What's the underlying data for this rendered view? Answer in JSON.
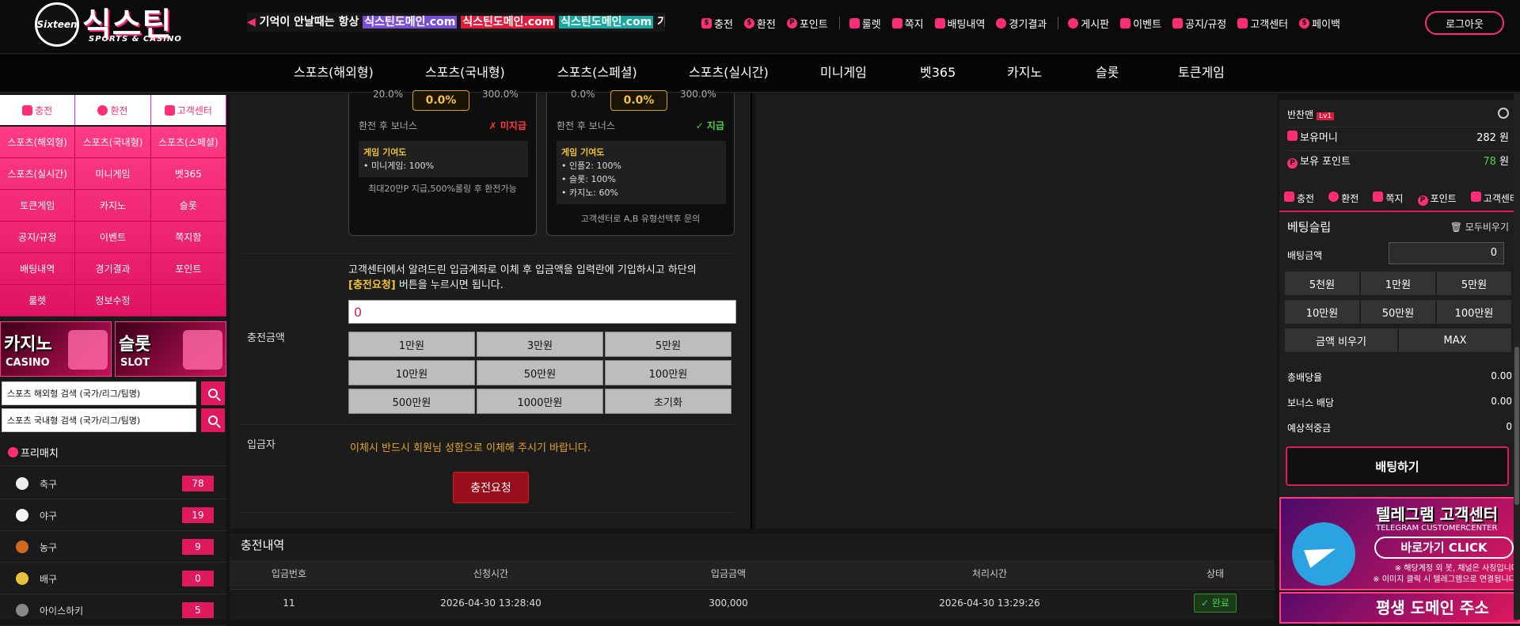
{
  "header": {
    "logo_badge": "Sixteen",
    "logo_title": "식스틴",
    "logo_sub": "SPORTS & CASINO",
    "ticker_pre": "기억이 안날때는 항상",
    "ticker_d1": "식스틴도메인.com",
    "ticker_d2": "식스틴도메인.com",
    "ticker_d3": "식스틴도메인.com",
    "ticker_post": "기억해 주",
    "nav1": [
      "충전",
      "환전",
      "포인트"
    ],
    "nav2": [
      "룰렛",
      "쪽지",
      "배팅내역",
      "경기결과"
    ],
    "nav3": [
      "게시판",
      "이벤트",
      "공지/규정",
      "고객센터",
      "페이백"
    ],
    "logout": "로그아웃"
  },
  "mainnav": [
    "스포츠(해외형)",
    "스포츠(국내형)",
    "스포츠(스페셜)",
    "스포츠(실시간)",
    "미니게임",
    "벳365",
    "카지노",
    "슬롯",
    "토큰게임"
  ],
  "left": {
    "quick_tabs": [
      "충전",
      "환전",
      "고객센터"
    ],
    "grid": [
      "스포츠(해외형)",
      "스포츠(국내형)",
      "스포츠(스페셜)",
      "스포츠(실시간)",
      "미니게임",
      "벳365",
      "토큰게임",
      "카지노",
      "슬롯",
      "공지/규정",
      "이벤트",
      "쪽지함",
      "배팅내역",
      "경기결과",
      "포인트",
      "룰렛",
      "정보수정",
      ""
    ],
    "banner_casino_kr": "카지노",
    "banner_casino_en": "CASINO",
    "banner_slot_kr": "슬롯",
    "banner_slot_en": "SLOT",
    "search1": "스포츠 해외형 검색 (국가/리그/팀명)",
    "search2": "스포츠 국내형 검색 (국가/리그/팀명)",
    "prematch": "프리매치",
    "sports": [
      {
        "name": "축구",
        "count": "78",
        "color": "#eeeeee"
      },
      {
        "name": "야구",
        "count": "19",
        "color": "#f5f5f5"
      },
      {
        "name": "농구",
        "count": "9",
        "color": "#d2691e"
      },
      {
        "name": "배구",
        "count": "0",
        "color": "#e8c33a"
      },
      {
        "name": "아이스하키",
        "count": "5",
        "color": "#888888"
      }
    ]
  },
  "cards": [
    {
      "pct_left": "20.0%",
      "pct": "0.0%",
      "pct_right": "300.0%",
      "bonus_label": "환전 후 보너스",
      "bonus_status": "✗ 미지급",
      "status_color": "#ff3b3b",
      "game_title": "게임 기여도",
      "games": [
        "미니게임: 100%"
      ],
      "note": "최대20만P 지급,500%롤링 후 환전가능"
    },
    {
      "pct_left": "0.0%",
      "pct": "0.0%",
      "pct_right": "300.0%",
      "bonus_label": "환전 후 보너스",
      "bonus_status": "✓ 지급",
      "status_color": "#4cd04c",
      "game_title": "게임 기여도",
      "games": [
        "인플2: 100%",
        "슬롯: 100%",
        "카지노: 60%"
      ],
      "note": "고객센터로 A,B 유형선택후 문의"
    }
  ],
  "form": {
    "desc_1": "고객센터에서 알려드린 입금계좌로 이체 후 입금액을 입력란에 기입하시고 하단의",
    "desc_highlight": "[충전요청]",
    "desc_2": "버튼을 누르시면 됩니다.",
    "amount_label": "충전금액",
    "amount_value": "0",
    "amount_buttons": [
      "1만원",
      "3만원",
      "5만원",
      "10만원",
      "50만원",
      "100만원",
      "500만원",
      "1000만원",
      "초기화"
    ],
    "depositor_label": "입금자",
    "depositor_note": "이체시 반드시 회원님 성함으로 이체해 주시기 바랍니다.",
    "submit": "충전요청"
  },
  "history": {
    "title": "충전내역",
    "columns": [
      "입금번호",
      "신청시간",
      "입금금액",
      "처리시간",
      "상태"
    ],
    "rows": [
      {
        "id": "11",
        "requested": "2026-04-30 13:28:40",
        "amount": "300,000",
        "processed": "2026-04-30 13:29:26",
        "status": "완료"
      }
    ]
  },
  "user": {
    "name": "반찬맨",
    "level": "Lv1",
    "money_label": "보유머니",
    "money": "282 원",
    "point_label": "보유 포인트",
    "point_num": "78",
    "point_unit": " 원",
    "links": [
      "충전",
      "환전",
      "쪽지",
      "포인트",
      "고객센터"
    ]
  },
  "slip": {
    "title": "베팅슬립",
    "clear_all": "모두비우기",
    "bet_label": "배팅금액",
    "bet_value": "0",
    "chips": [
      "5천원",
      "1만원",
      "5만원",
      "10만원",
      "50만원",
      "100만원"
    ],
    "clear_amount": "금액 비우기",
    "max": "MAX",
    "total_odds_label": "총배당율",
    "total_odds": "0.00",
    "bonus_odds_label": "보너스 배당",
    "bonus_odds": "0.00",
    "expected_label": "예상적중금",
    "expected": "0",
    "bet_button": "배팅하기"
  },
  "telegram_banner": {
    "title": "텔레그램 고객센터",
    "sub": "TELEGRAM CUSTOMERCENTER",
    "cta": "바로가기 CLICK",
    "note1": "※ 해당계정 외 봇, 채널은 사칭입니다",
    "note2": "※ 이미지 클릭 시 텔레그램으로 연결됩니다."
  },
  "domain_banner": {
    "title": "평생 도메인 주소"
  },
  "colors": {
    "accent": "#e0185e",
    "gold": "#f2c236"
  }
}
